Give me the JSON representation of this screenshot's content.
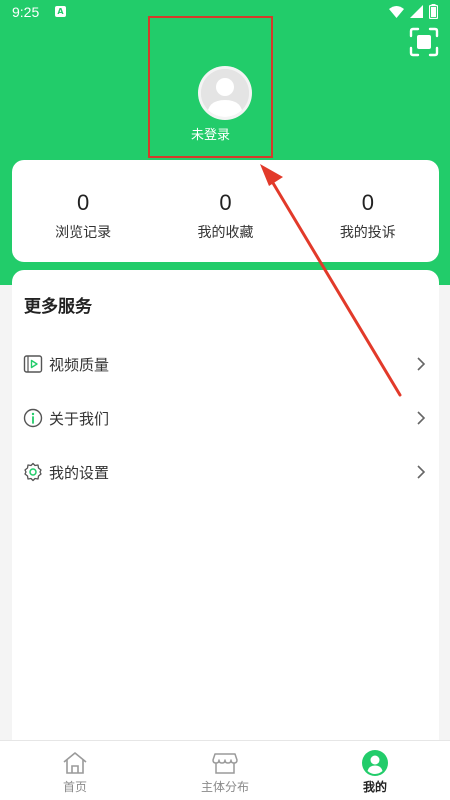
{
  "status_bar": {
    "time": "9:25",
    "notification_letter": "A"
  },
  "header": {
    "login_text": "未登录",
    "accent_color": "#22cc6a",
    "highlight_color": "#d63a2a"
  },
  "stats": [
    {
      "value": "0",
      "label": "浏览记录"
    },
    {
      "value": "0",
      "label": "我的收藏"
    },
    {
      "value": "0",
      "label": "我的投诉"
    }
  ],
  "services": {
    "title": "更多服务",
    "items": [
      {
        "label": "视频质量",
        "icon": "video-quality-icon"
      },
      {
        "label": "关于我们",
        "icon": "info-icon"
      },
      {
        "label": "我的设置",
        "icon": "settings-icon"
      }
    ]
  },
  "bottom_nav": {
    "items": [
      {
        "label": "首页",
        "icon": "home-icon"
      },
      {
        "label": "主体分布",
        "icon": "store-icon"
      },
      {
        "label": "我的",
        "icon": "profile-icon"
      }
    ]
  }
}
